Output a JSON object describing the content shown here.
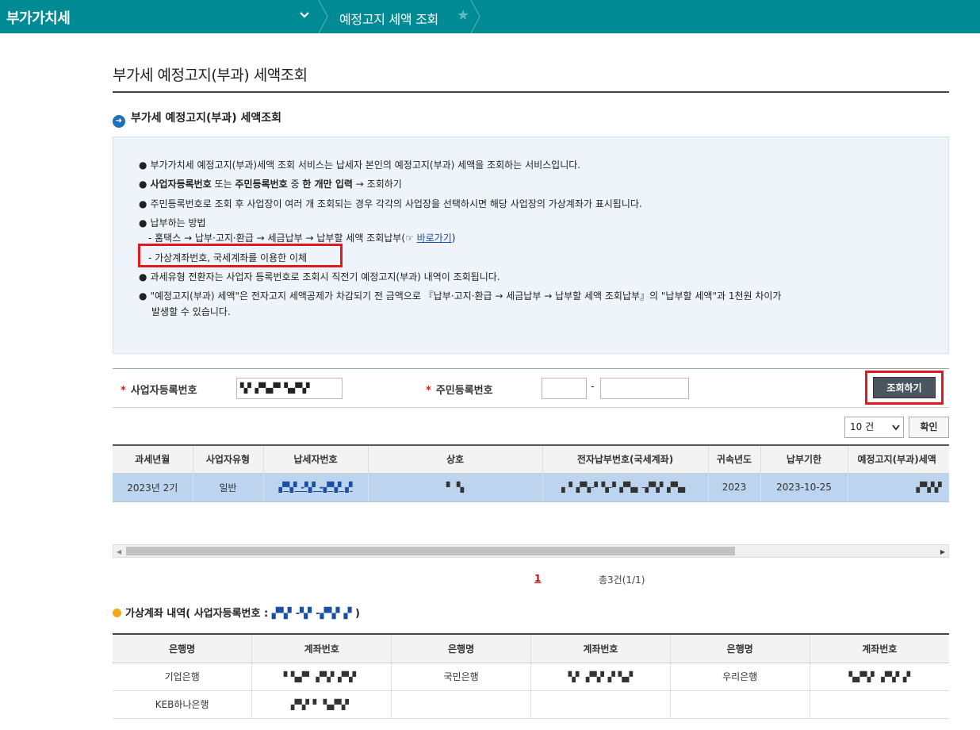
{
  "topbar": {
    "menu_title": "부가가치세",
    "page_title": "예정고지 세액 조회"
  },
  "page": {
    "title": "부가세 예정고지(부과) 세액조회",
    "section_title": "부가세 예정고지(부과) 세액조회"
  },
  "info": {
    "bullet": "●",
    "line1": "부가가치세 예정고지(부과)세액 조회 서비스는 납세자 본인의 예정고지(부과) 세액을 조회하는 서비스입니다.",
    "line2_b1": "사업자등록번호",
    "line2_m1": " 또는 ",
    "line2_b2": "주민등록번호",
    "line2_m2": " 중 ",
    "line2_b3": "한 개만 입력",
    "line2_m3": " → 조회하기",
    "line3": "주민등록번호로 조회 후 사업장이 여러 개 조회되는 경우 각각의 사업장을 선택하시면 해당 사업장의 가상계좌가 표시됩니다.",
    "line4": "납부하는 방법",
    "line5_a": "- 홈택스 → 납부·고지·환급 → 세금납부 → 납부할 세액 조회납부(☞ ",
    "line5_link": "바로가기",
    "line5_b": ")",
    "line6": "- 가상계좌번호, 국세계좌를 이용한 이체",
    "line7": "과세유형 전환자는 사업자 등록번호로 조회시 직전기 예정고지(부과) 내역이 조회됩니다.",
    "line8": "\"예정고지(부과) 세액\"은 전자고지 세액공제가 차감되기 전 금액으로 『납부·고지·환급 → 세금납부 → 납부할 세액 조회납부』의 \"납부할 세액\"과 1천원 차이가",
    "line9": "발생할 수 있습니다."
  },
  "search": {
    "required_mark": "*",
    "biz_label": "사업자등록번호",
    "biz_value": "▚▘▞▚▞▘▚▞▚▘",
    "rrn_label": "주민등록번호",
    "rrn_front": "",
    "rrn_dash": "-",
    "rrn_back": "",
    "button": "조회하기"
  },
  "paging": {
    "page_size": "10 건",
    "confirm": "확인",
    "current_page": "1",
    "total": "총3건(1/1)"
  },
  "grid": {
    "headers": [
      "과세년월",
      "사업자유형",
      "납세자번호",
      "상호",
      "전자납부번호(국세계좌)",
      "귀속년도",
      "납부기한",
      "예정고지(부과)세액"
    ],
    "row": {
      "period": "2023년 2기",
      "biz_type": "일반",
      "taxpayer_no": "▞▚▘-▚▘-▞▚▘▞",
      "company": "▘  ▚",
      "payment_no": "▖▘▞▚-▘▚-▘▞▚▖-▞▚▘▞▚▖",
      "year": "2023",
      "due_date": "2023-10-25",
      "amount": "▞▚▚▘"
    }
  },
  "accounts": {
    "title_prefix": "가상계좌 내역( 사업자등록번호 : ",
    "biz_no": "▞▚▘-▚▘-▞▚▘▞",
    "title_suffix": " )",
    "headers": [
      "은행명",
      "계좌번호",
      "은행명",
      "계좌번호",
      "은행명",
      "계좌번호"
    ],
    "rows": [
      [
        "기업은행",
        "▘▚▞▘ ▞▚▘▞▚▘",
        "국민은행",
        "▚▘ ▞▚▘▞ ▚▞",
        "우리은행",
        "▚▞▚▘ ▞▚▘▞"
      ],
      [
        "KEB하나은행",
        "▞▚▘▘ ▚▞▚▘",
        "",
        "",
        "",
        ""
      ]
    ]
  }
}
